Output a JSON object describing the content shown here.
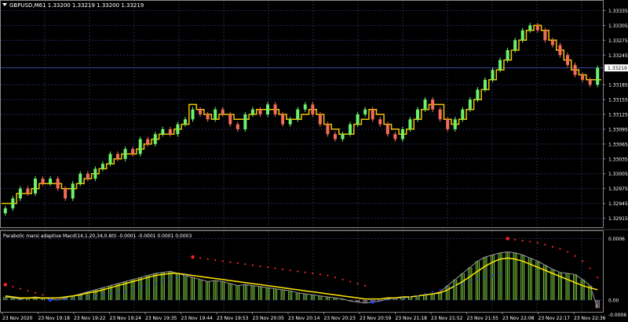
{
  "main_panel": {
    "symbol_dropdown_icon": "triangle-down-icon",
    "title": "GBPUSD,M61  1.33200 1.33219 1.33200 1.33219",
    "current_price": "1.33219",
    "price_axis_labels": [
      "1.33335",
      "1.33305",
      "1.33275",
      "1.33245",
      "1.33185",
      "1.33155",
      "1.33125",
      "1.33095",
      "1.33065",
      "1.33035",
      "1.33005",
      "1.32975",
      "1.32945",
      "1.32915"
    ]
  },
  "indicator_panel": {
    "title": "Parabolic marsi adaptive Macd(14,1.20,34,0.80) -0.0001 -0.0001 0.0001 0.0003",
    "axis_labels": [
      "0.0006",
      "0.00",
      "-0.0006"
    ]
  },
  "time_axis": {
    "labels": [
      "23 Nov 2020",
      "23 Nov 19:18",
      "23 Nov 19:22",
      "23 Nov 19:24",
      "23 Nov 19:35",
      "23 Nov 19:44",
      "23 Nov 19:53",
      "23 Nov 20:05",
      "23 Nov 20:14",
      "23 Nov 20:23",
      "23 Nov 20:59",
      "23 Nov 21:18",
      "23 Nov 21:52",
      "23 Nov 21:55",
      "23 Nov 22:08",
      "23 Nov 22:17",
      "23 Nov 22:36"
    ]
  },
  "colors": {
    "background": "#000000",
    "grid": "#1e2a55",
    "bull": "#6cf26c",
    "bear": "#f26c5a",
    "signal": "#f2c300",
    "macd_line": "#ffe600",
    "psar": "#ff2020",
    "psar_low": "#2040ff",
    "hist_bull": "#7fd040",
    "hist_bear": "#c0a0c0",
    "current_price_line": "#3a4a9a"
  },
  "chart_data": [
    {
      "type": "candlestick",
      "title": "GBPUSD,M61  1.33200 1.33219 1.33200 1.33219",
      "ylim": [
        1.329,
        1.3335
      ],
      "y_ticks": [
        1.33335,
        1.33305,
        1.33275,
        1.33245,
        1.33185,
        1.33155,
        1.33125,
        1.33095,
        1.33065,
        1.33035,
        1.33005,
        1.32975,
        1.32945,
        1.32915
      ],
      "current_price": 1.33219,
      "close": [
        1.32935,
        1.32955,
        1.32975,
        1.32965,
        1.32995,
        1.32985,
        1.32995,
        1.32975,
        1.32955,
        1.32985,
        1.33005,
        1.32995,
        1.33015,
        1.33025,
        1.33045,
        1.33035,
        1.33055,
        1.33045,
        1.33075,
        1.33065,
        1.33085,
        1.33095,
        1.33085,
        1.33105,
        1.33115,
        1.33135,
        1.33125,
        1.33115,
        1.33135,
        1.33125,
        1.33105,
        1.33095,
        1.33125,
        1.33135,
        1.33125,
        1.33145,
        1.33125,
        1.33105,
        1.33115,
        1.33135,
        1.33145,
        1.33125,
        1.33105,
        1.33085,
        1.33075,
        1.33085,
        1.33105,
        1.33125,
        1.33135,
        1.33115,
        1.33105,
        1.33085,
        1.33075,
        1.33095,
        1.33115,
        1.33135,
        1.33155,
        1.33135,
        1.33115,
        1.33095,
        1.33115,
        1.33135,
        1.33155,
        1.33175,
        1.33195,
        1.33215,
        1.33235,
        1.33255,
        1.33275,
        1.33295,
        1.33305,
        1.33295,
        1.33275,
        1.33265,
        1.33245,
        1.33225,
        1.33205,
        1.33195,
        1.33185,
        1.33219
      ],
      "signal": [
        1.32945,
        1.32945,
        1.32965,
        1.32965,
        1.32975,
        1.32985,
        1.32985,
        1.32985,
        1.32975,
        1.32975,
        1.32985,
        1.32995,
        1.33005,
        1.33015,
        1.33025,
        1.33035,
        1.33045,
        1.33045,
        1.33055,
        1.33065,
        1.33075,
        1.33085,
        1.33085,
        1.33095,
        1.33105,
        1.33145,
        1.33135,
        1.33125,
        1.33115,
        1.33125,
        1.33125,
        1.33115,
        1.33115,
        1.33125,
        1.33135,
        1.33135,
        1.33135,
        1.33125,
        1.33115,
        1.33115,
        1.33125,
        1.33135,
        1.33125,
        1.33105,
        1.33095,
        1.33085,
        1.33085,
        1.33105,
        1.33115,
        1.33135,
        1.33125,
        1.33105,
        1.33095,
        1.33085,
        1.33095,
        1.33115,
        1.33135,
        1.33145,
        1.33145,
        1.33115,
        1.33105,
        1.33115,
        1.33135,
        1.33155,
        1.33175,
        1.33195,
        1.33215,
        1.33235,
        1.33255,
        1.33275,
        1.33295,
        1.33305,
        1.33295,
        1.33275,
        1.33255,
        1.33235,
        1.33215,
        1.33205,
        1.33195,
        1.33195
      ]
    },
    {
      "type": "bar",
      "title": "Parabolic marsi adaptive Macd(14,1.20,34,0.80) -0.0001 -0.0001 0.0001 0.0003",
      "ylim": [
        -0.0001,
        0.00065
      ],
      "histogram": [
        3e-05,
        2e-05,
        1e-05,
        2e-05,
        3e-05,
        2e-05,
        1e-05,
        0.0,
        2e-05,
        4e-05,
        6e-05,
        8e-05,
        0.0001,
        0.00012,
        0.00014,
        0.00016,
        0.00018,
        0.0002,
        0.00022,
        0.00024,
        0.00026,
        0.00027,
        0.00028,
        0.00026,
        0.00024,
        0.00022,
        0.0002,
        0.00018,
        0.00019,
        0.00018,
        0.00016,
        0.00014,
        0.00015,
        0.00014,
        0.00013,
        0.00012,
        0.00011,
        0.0001,
        9e-05,
        7e-05,
        6e-05,
        5e-05,
        4e-05,
        3e-05,
        2e-05,
        1e-05,
        -1e-05,
        -2e-05,
        -3e-05,
        -2e-05,
        -1e-05,
        1e-05,
        2e-05,
        2e-05,
        3e-05,
        4e-05,
        5e-05,
        6e-05,
        8e-05,
        0.00014,
        0.0002,
        0.00026,
        0.00032,
        0.00038,
        0.00042,
        0.00044,
        0.00046,
        0.00047,
        0.00046,
        0.00044,
        0.00041,
        0.00038,
        0.00034,
        0.0003,
        0.00027,
        0.00026,
        0.00025,
        0.0002,
        0.00014,
        -8e-05
      ],
      "macd_line": [
        4e-05,
        3e-05,
        2e-05,
        2e-05,
        2e-05,
        2e-05,
        2e-05,
        2e-05,
        3e-05,
        4e-05,
        5e-05,
        7e-05,
        8e-05,
        0.0001,
        0.00012,
        0.00014,
        0.00016,
        0.00018,
        0.0002,
        0.00022,
        0.00024,
        0.00025,
        0.00026,
        0.00026,
        0.00025,
        0.00024,
        0.00023,
        0.00022,
        0.00021,
        0.0002,
        0.00019,
        0.00018,
        0.00017,
        0.00016,
        0.00015,
        0.00014,
        0.00013,
        0.00012,
        0.00011,
        0.0001,
        9e-05,
        8e-05,
        7e-05,
        6e-05,
        5e-05,
        4e-05,
        3e-05,
        2e-05,
        1e-05,
        1e-05,
        1e-05,
        2e-05,
        2e-05,
        3e-05,
        3e-05,
        4e-05,
        5e-05,
        6e-05,
        7e-05,
        0.0001,
        0.00014,
        0.00018,
        0.00023,
        0.00028,
        0.00033,
        0.00037,
        0.0004,
        0.00041,
        0.0004,
        0.00038,
        0.00035,
        0.00032,
        0.00029,
        0.00026,
        0.00023,
        0.0002,
        0.00017,
        0.00014,
        0.00012,
        0.0001
      ],
      "psar_high": [
        0.00015,
        0.00013,
        0.00011,
        9e-05,
        7e-05,
        5e-05,
        null,
        null,
        null,
        null,
        null,
        null,
        null,
        null,
        null,
        null,
        null,
        null,
        null,
        null,
        null,
        null,
        null,
        null,
        null,
        0.00042,
        0.00041,
        0.0004,
        0.00039,
        0.00038,
        0.00037,
        0.00036,
        0.00035,
        0.00034,
        0.00033,
        0.00032,
        0.00031,
        0.0003,
        0.00029,
        0.00028,
        0.00027,
        0.00026,
        0.00025,
        0.00024,
        0.00022,
        0.0002,
        0.00018,
        0.00016,
        0.00014,
        null,
        null,
        null,
        null,
        null,
        null,
        null,
        null,
        null,
        null,
        null,
        null,
        null,
        null,
        null,
        null,
        null,
        null,
        0.0006,
        0.00059,
        0.00058,
        0.00057,
        0.00056,
        0.00054,
        0.00052,
        0.0005,
        0.00047,
        0.00043,
        0.00038,
        0.00031,
        0.00022
      ],
      "psar_low": [
        null,
        null,
        null,
        null,
        null,
        null,
        0.0,
        0.0,
        1e-05,
        1e-05,
        2e-05,
        3e-05,
        4e-05,
        5e-05,
        6e-05,
        7e-05,
        8e-05,
        0.0001,
        0.00012,
        0.00014,
        0.00016,
        0.00018,
        0.0002,
        0.00022,
        0.00024,
        null,
        null,
        null,
        null,
        null,
        null,
        null,
        null,
        null,
        null,
        null,
        null,
        null,
        null,
        null,
        null,
        null,
        null,
        null,
        null,
        null,
        null,
        null,
        null,
        -2e-05,
        -1e-05,
        0.0,
        1e-05,
        2e-05,
        3e-05,
        4e-05,
        6e-05,
        8e-05,
        0.0001,
        0.00012,
        0.00014,
        0.00016,
        0.00018,
        0.0002,
        0.00022,
        0.00024,
        0.00026,
        null,
        null,
        null,
        null,
        null,
        null,
        null,
        null,
        null,
        null,
        null,
        null,
        null
      ]
    }
  ]
}
